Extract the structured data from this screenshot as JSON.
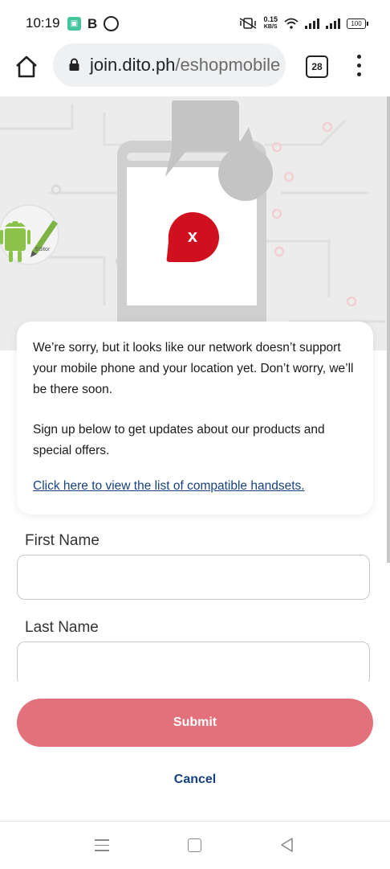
{
  "status_bar": {
    "time": "10:19",
    "notification_icons": [
      "app-icon",
      "b-icon",
      "messenger-icon"
    ],
    "net_speed_value": "0.15",
    "net_speed_unit": "KB/S",
    "battery": "100"
  },
  "browser": {
    "url_host": "join.dito.ph",
    "url_path": "/eshopmobile",
    "tab_count": "28"
  },
  "hero": {
    "error_mark": "x",
    "accent_color": "#d0101e"
  },
  "message": {
    "line1": "We’re sorry, but it looks like our network doesn’t support your mobile phone and your location yet. Don’t worry, we’ll be there soon.",
    "line2": "Sign up below to get updates about our products and special offers.",
    "link": "Click here to view the list of compatible handsets."
  },
  "form": {
    "first_name_label": "First Name",
    "first_name_value": "",
    "last_name_label": "Last Name",
    "last_name_value": ""
  },
  "actions": {
    "submit_label": "Submit",
    "cancel_label": "Cancel",
    "submit_color": "#e2717b",
    "link_color": "#17417e"
  }
}
